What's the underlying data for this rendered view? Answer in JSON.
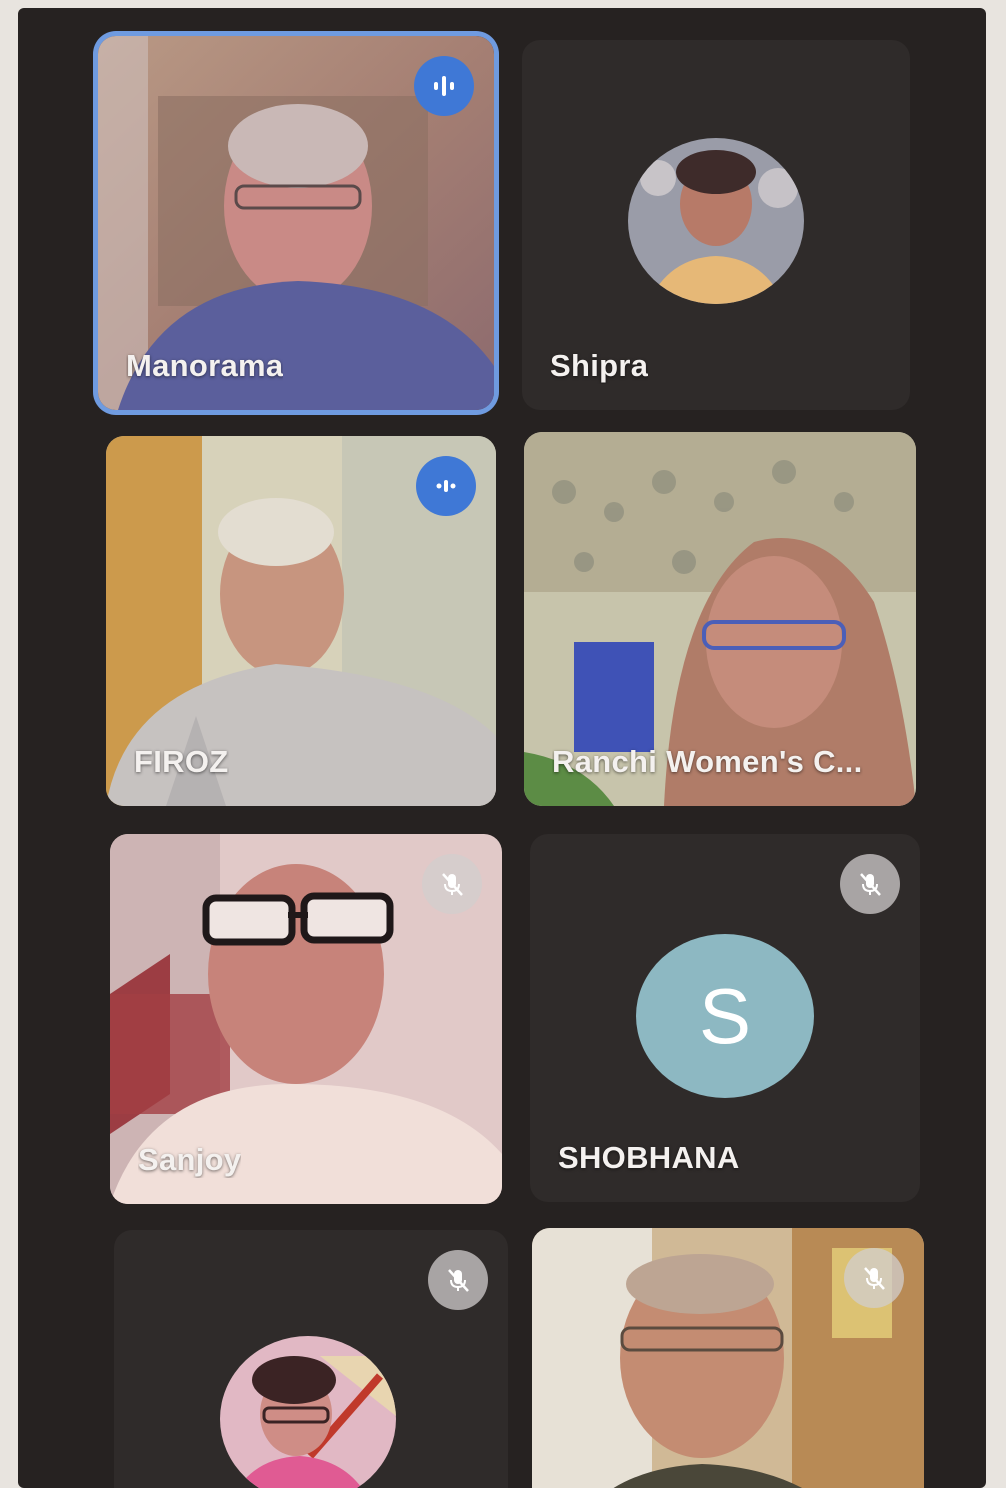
{
  "participants": [
    {
      "name": "Manorama",
      "status": "speaking",
      "active": true,
      "badge_icon": "speaking-indicator-icon"
    },
    {
      "name": "Shipra",
      "status": "idle",
      "active": false
    },
    {
      "name": "FIROZ",
      "status": "speaking",
      "active": false,
      "badge_icon": "speaking-indicator-icon"
    },
    {
      "name": "Ranchi Women's C...",
      "status": "idle",
      "active": false
    },
    {
      "name": "Sanjoy",
      "status": "muted",
      "active": false,
      "badge_icon": "mic-off-icon"
    },
    {
      "name": "SHOBHANA",
      "status": "muted",
      "active": false,
      "badge_icon": "mic-off-icon",
      "avatar_letter": "S",
      "avatar_color": "#8db8c2"
    },
    {
      "name": "",
      "status": "muted",
      "active": false,
      "badge_icon": "mic-off-icon"
    },
    {
      "name": "",
      "status": "muted",
      "active": false,
      "badge_icon": "mic-off-icon"
    }
  ],
  "colors": {
    "background": "#262221",
    "tile": "#2f2b2a",
    "active_border": "#6f9be0",
    "speaking_badge": "#3f78d6"
  }
}
